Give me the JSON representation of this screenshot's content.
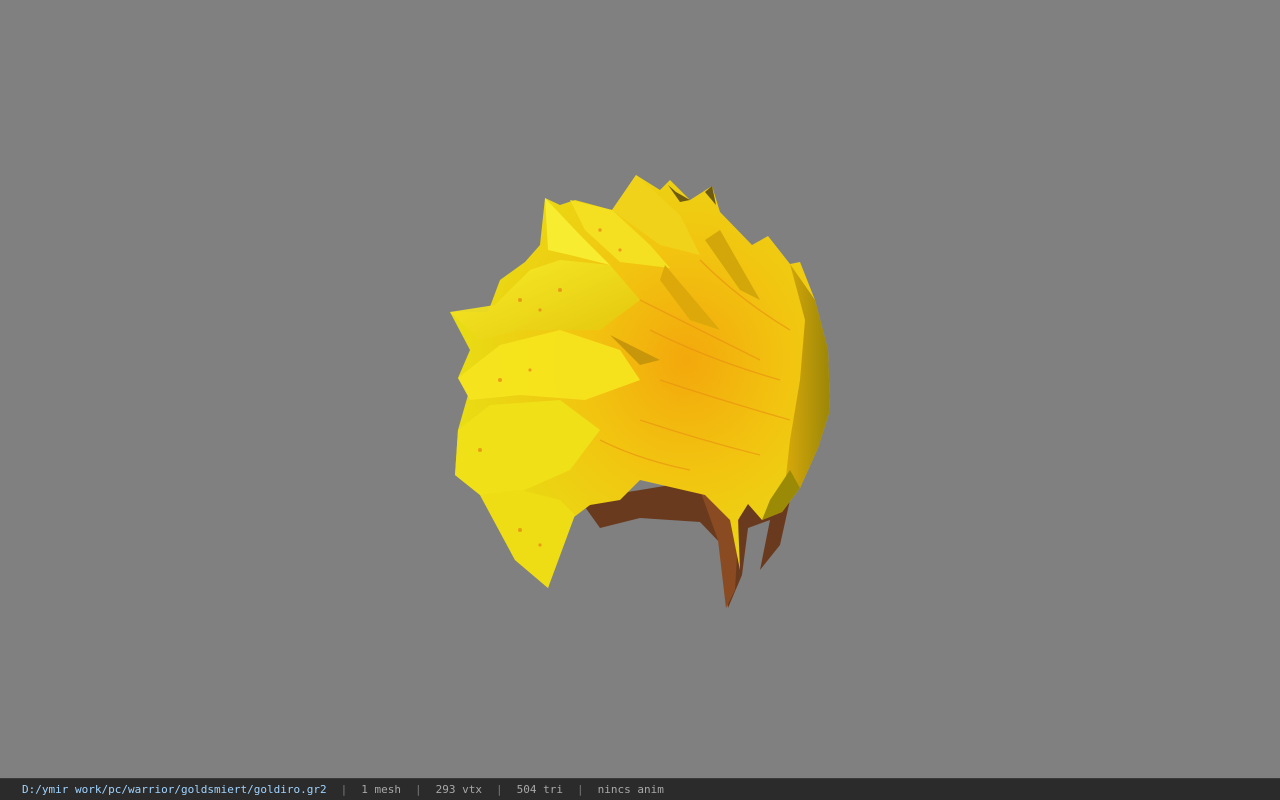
{
  "viewer": {
    "background_color": "#808080",
    "model_icon": "spiky-blonde-hair-model-icon",
    "model_colors": {
      "hair_light": "#f4e21a",
      "hair_mid": "#f2c40f",
      "hair_dark": "#b98e06",
      "scalp": "#6a3a1e"
    }
  },
  "status": {
    "file_path": "D:/ymir work/pc/warrior/goldsmiert/goldiro.gr2",
    "separator": "|",
    "mesh_count": "1 mesh",
    "vertex_count": "293 vtx",
    "triangle_count": "504 tri",
    "animation": "nincs anim"
  }
}
